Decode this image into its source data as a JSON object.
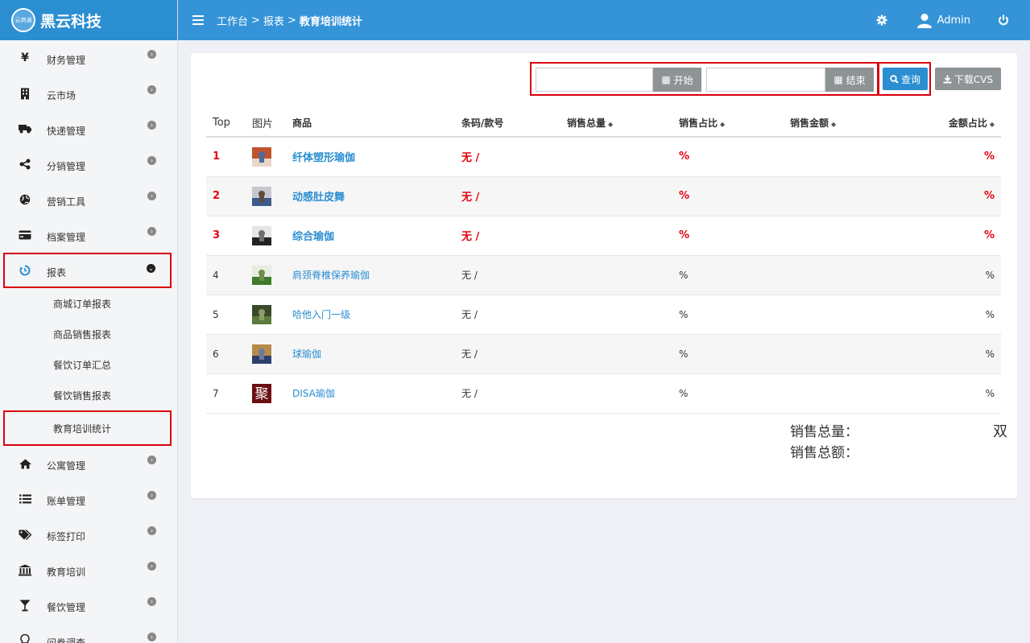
{
  "brand": {
    "logo_text": "云商通",
    "name": "黑云科技"
  },
  "sidebar": {
    "items_top": [
      {
        "label": "财务管理",
        "icon": "yen-icon"
      },
      {
        "label": "云市场",
        "icon": "building-icon"
      },
      {
        "label": "快递管理",
        "icon": "truck-icon"
      },
      {
        "label": "分销管理",
        "icon": "share-icon"
      },
      {
        "label": "营销工具",
        "icon": "globe-icon"
      },
      {
        "label": "档案管理",
        "icon": "card-icon"
      }
    ],
    "active_item": {
      "label": "报表",
      "icon": "history-icon"
    },
    "sub_items": [
      "商城订单报表",
      "商品销售报表",
      "餐饮订单汇总",
      "餐饮销售报表",
      "教育培训统计"
    ],
    "items_bottom": [
      {
        "label": "公寓管理",
        "icon": "home-icon"
      },
      {
        "label": "账单管理",
        "icon": "list-icon"
      },
      {
        "label": "标签打印",
        "icon": "tags-icon"
      },
      {
        "label": "教育培训",
        "icon": "bank-icon"
      },
      {
        "label": "餐饮管理",
        "icon": "glass-icon"
      },
      {
        "label": "问卷调查",
        "icon": "lightbulb-icon"
      }
    ]
  },
  "topbar": {
    "breadcrumb": [
      "工作台",
      "报表",
      "教育培训统计"
    ],
    "separator": ">",
    "user": "Admin"
  },
  "filters": {
    "start_label": "开始",
    "end_label": "结束",
    "start_value": "",
    "end_value": "",
    "query_label": "查询",
    "download_label": "下载CVS"
  },
  "table": {
    "columns": [
      "Top",
      "图片",
      "商品",
      "条码/款号",
      "销售总量",
      "销售占比",
      "销售金额",
      "金额占比"
    ],
    "rows": [
      {
        "rank": "1",
        "name": "纤体塑形瑜伽",
        "code": "无 /",
        "qty": "",
        "ratio": "%",
        "amount": "",
        "amount_ratio": "%",
        "thumb": [
          "#e8d7c7",
          "#c3532d",
          "#4c6b9c"
        ]
      },
      {
        "rank": "2",
        "name": "动感肚皮舞",
        "code": "无 /",
        "qty": "",
        "ratio": "%",
        "amount": "",
        "amount_ratio": "%",
        "thumb": [
          "#3c5a8a",
          "#c6c8cf",
          "#5d4b3e"
        ]
      },
      {
        "rank": "3",
        "name": "综合瑜伽",
        "code": "无 /",
        "qty": "",
        "ratio": "%",
        "amount": "",
        "amount_ratio": "%",
        "thumb": [
          "#222222",
          "#e5e5e5",
          "#6e6e6e"
        ]
      },
      {
        "rank": "4",
        "name": "肩颈脊椎保养瑜伽",
        "code": "无 /",
        "qty": "",
        "ratio": "%",
        "amount": "",
        "amount_ratio": "%",
        "thumb": [
          "#3f7a2a",
          "#e8ede2",
          "#6b8f4a"
        ]
      },
      {
        "rank": "5",
        "name": "哈他入门一级",
        "code": "无 /",
        "qty": "",
        "ratio": "%",
        "amount": "",
        "amount_ratio": "%",
        "thumb": [
          "#5d7a3e",
          "#3a4a2a",
          "#8c9c6a"
        ]
      },
      {
        "rank": "6",
        "name": "球瑜伽",
        "code": "无 /",
        "qty": "",
        "ratio": "%",
        "amount": "",
        "amount_ratio": "%",
        "thumb": [
          "#2d3f6a",
          "#b88a4a",
          "#6a7b9c"
        ]
      },
      {
        "rank": "7",
        "name": "DISA瑜伽",
        "code": "无 /",
        "qty": "",
        "ratio": "%",
        "amount": "",
        "amount_ratio": "%",
        "thumb_char": "聚",
        "thumb": [
          "#6b0f12",
          "#6b0f12",
          "#6b0f12"
        ]
      }
    ]
  },
  "summary": {
    "qty_label": "销售总量：",
    "qty_unit": "双",
    "amount_label": "销售总额："
  }
}
